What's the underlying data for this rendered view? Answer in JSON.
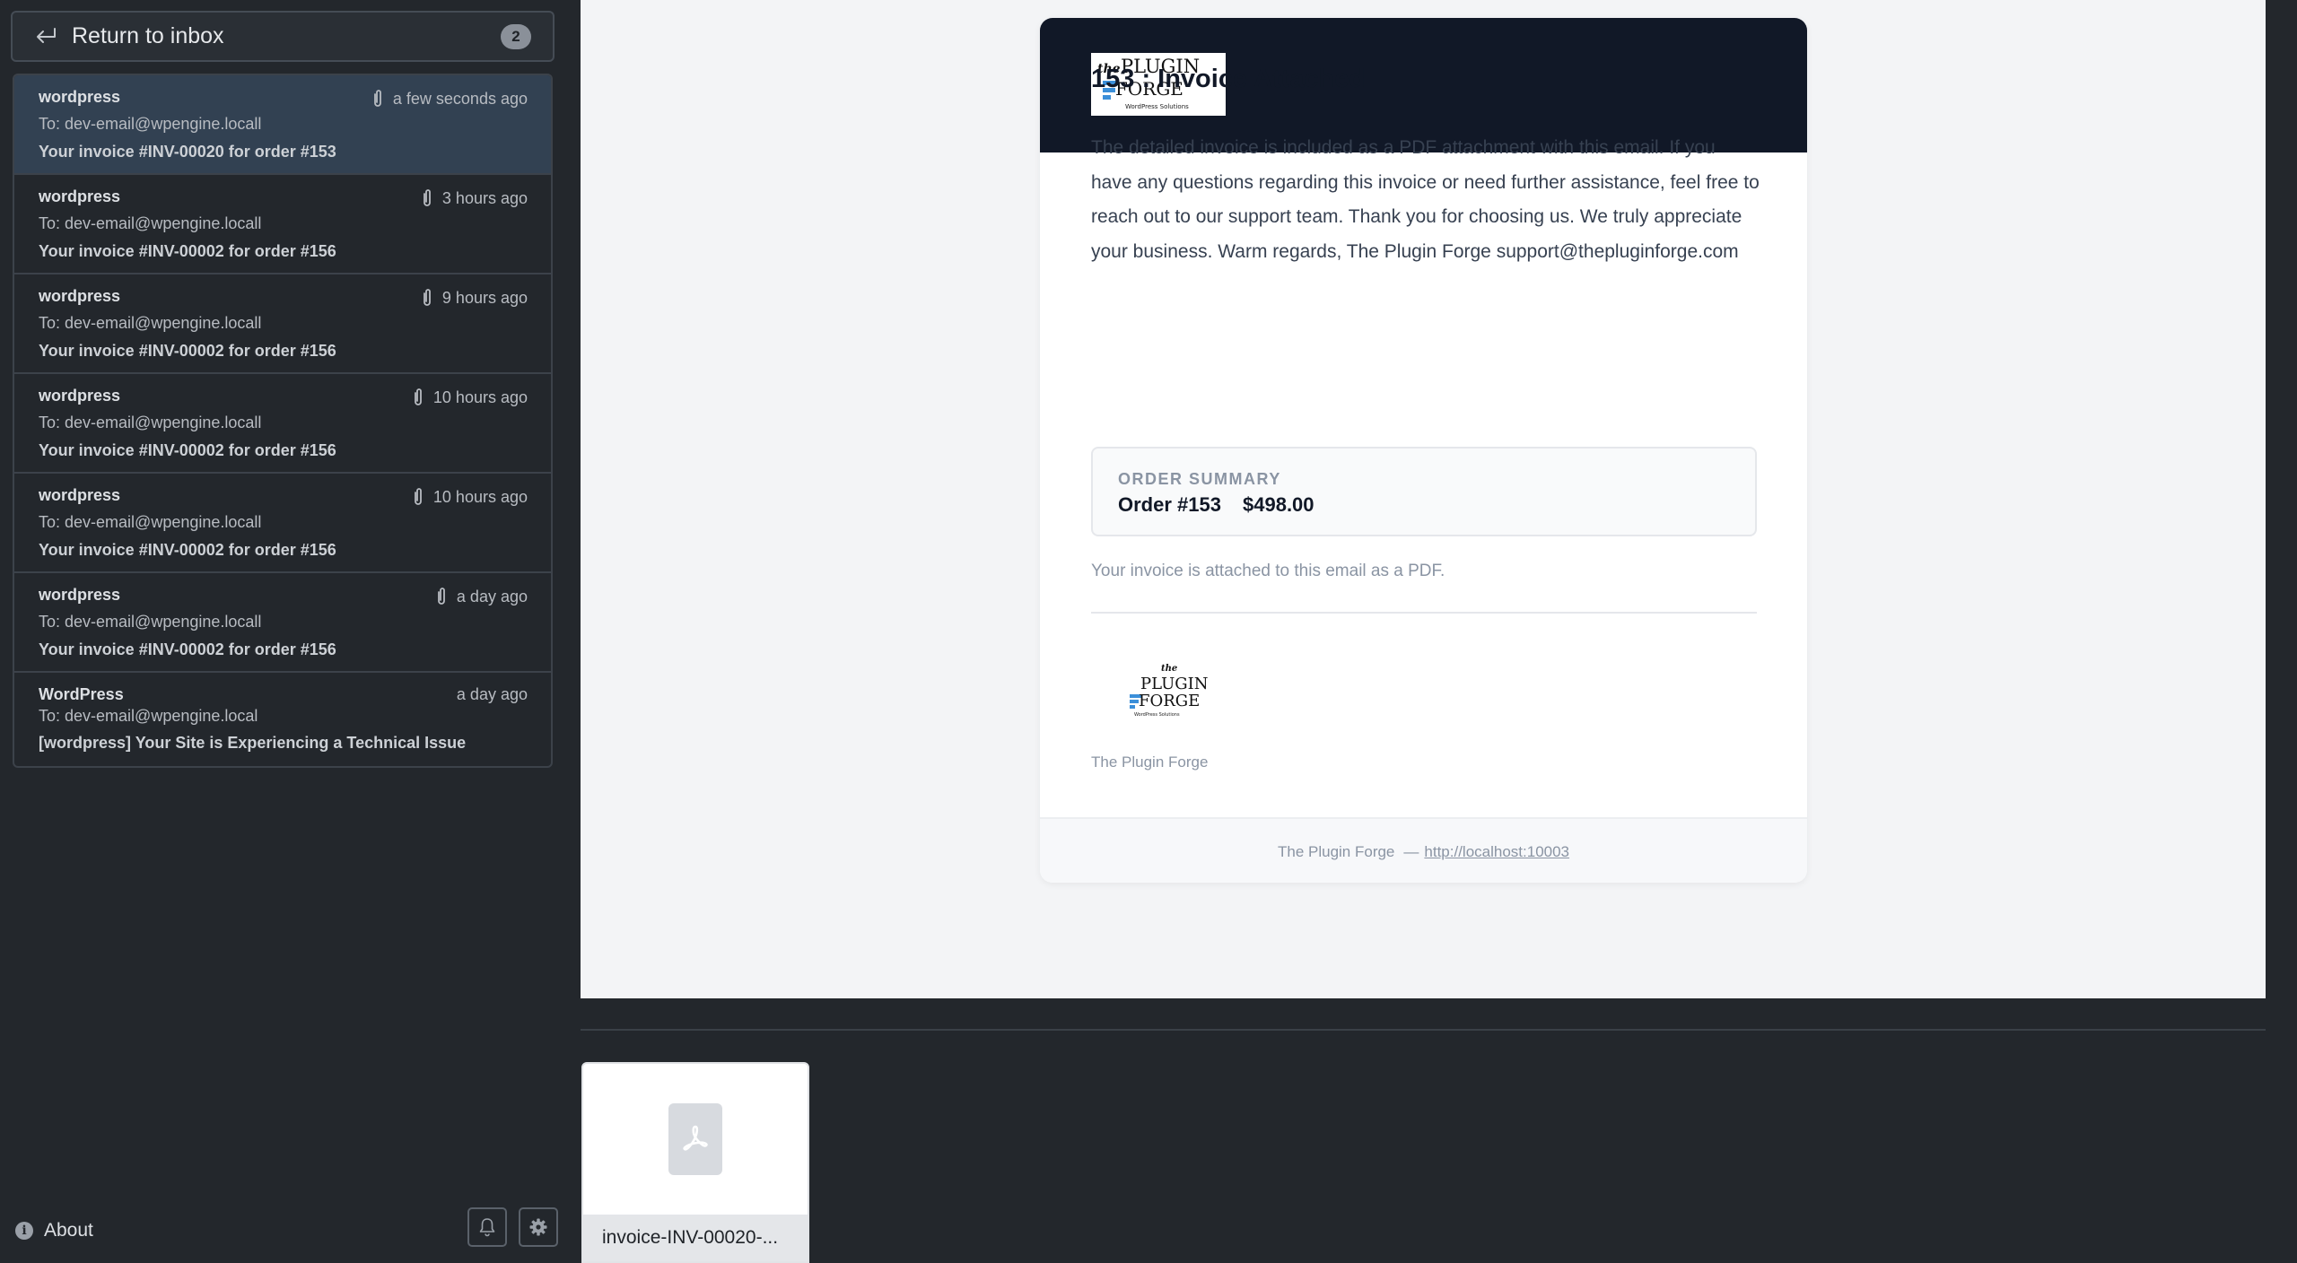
{
  "sidebar": {
    "return_label": "Return to inbox",
    "unread_count": "2",
    "messages": [
      {
        "from": "wordpress",
        "to": "To: dev-email@wpengine.locall",
        "subject": "Your invoice #INV-00020 for order #153",
        "time": "a few seconds ago",
        "has_attachment": true
      },
      {
        "from": "wordpress",
        "to": "To: dev-email@wpengine.locall",
        "subject": "Your invoice #INV-00002 for order #156",
        "time": "3 hours ago",
        "has_attachment": true
      },
      {
        "from": "wordpress",
        "to": "To: dev-email@wpengine.locall",
        "subject": "Your invoice #INV-00002 for order #156",
        "time": "9 hours ago",
        "has_attachment": true
      },
      {
        "from": "wordpress",
        "to": "To: dev-email@wpengine.locall",
        "subject": "Your invoice #INV-00002 for order #156",
        "time": "10 hours ago",
        "has_attachment": true
      },
      {
        "from": "wordpress",
        "to": "To: dev-email@wpengine.locall",
        "subject": "Your invoice #INV-00002 for order #156",
        "time": "10 hours ago",
        "has_attachment": true
      },
      {
        "from": "wordpress",
        "to": "To: dev-email@wpengine.locall",
        "subject": "Your invoice #INV-00002 for order #156",
        "time": "a day ago",
        "has_attachment": true
      },
      {
        "from": "WordPress",
        "to": "To: dev-email@wpengine.local",
        "subject": "[wordpress] Your Site is Experiencing a Technical Issue",
        "time": "a day ago",
        "has_attachment": false
      }
    ],
    "about_label": "About"
  },
  "email": {
    "logo": {
      "line1_prefix": "the",
      "line1": "PLUGIN",
      "line2": "FORGE",
      "tagline": "WordPress Solutions"
    },
    "title": "153 : Invoice Attached",
    "body": "The detailed invoice is included as a PDF attachment with this email. If you have any questions regarding this invoice or need further assistance, feel free to reach out to our support team. Thank you for choosing us. We truly appreciate your business. Warm regards, The Plugin Forge support@thepluginforge.com",
    "summary_label": "ORDER SUMMARY",
    "order": "Order #153",
    "total": "$498.00",
    "attached_note": "Your invoice is attached to this email as a PDF.",
    "brand_name": "The Plugin Forge",
    "footer_brand": "The Plugin Forge",
    "footer_sep": "—",
    "footer_link": "http://localhost:10003"
  },
  "attachment": {
    "name": "invoice-INV-00020-...",
    "icon": "pdf-icon"
  },
  "colors": {
    "sidebar_bg": "#23272c",
    "active_row": "#324152",
    "email_header": "#111827",
    "logo_blue": "#3b8fd9"
  }
}
